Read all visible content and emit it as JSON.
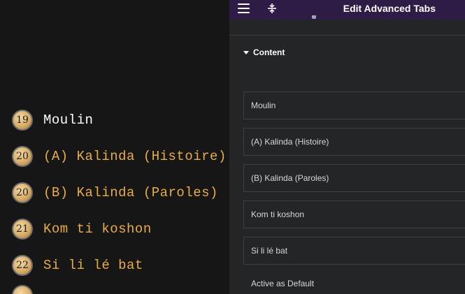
{
  "preview": {
    "tabs": [
      {
        "number": "19",
        "label": "Moulin",
        "active": true
      },
      {
        "number": "20",
        "label": "(A) Kalinda (Histoire)",
        "active": false
      },
      {
        "number": "20",
        "label": "(B) Kalinda (Paroles)",
        "active": false
      },
      {
        "number": "21",
        "label": "Kom ti koshon",
        "active": false
      },
      {
        "number": "22",
        "label": "Si li lé bat",
        "active": false
      }
    ]
  },
  "panel": {
    "title": "Edit Advanced Tabs",
    "header_icons": [
      "hamburger-icon",
      "drag-handle-icon"
    ],
    "section_title": "Content",
    "items": [
      "Moulin",
      "(A) Kalinda (Histoire)",
      "(B) Kalinda (Paroles)",
      "Kom ti koshon",
      "Si li lé bat"
    ],
    "default_label": "Active as Default"
  },
  "colors": {
    "preview_bg": "#161616",
    "tab_text": "#e8ad45",
    "tab_text_active": "#ffffff",
    "header_bg": "#2e1c47",
    "panel_bg": "#242527"
  }
}
